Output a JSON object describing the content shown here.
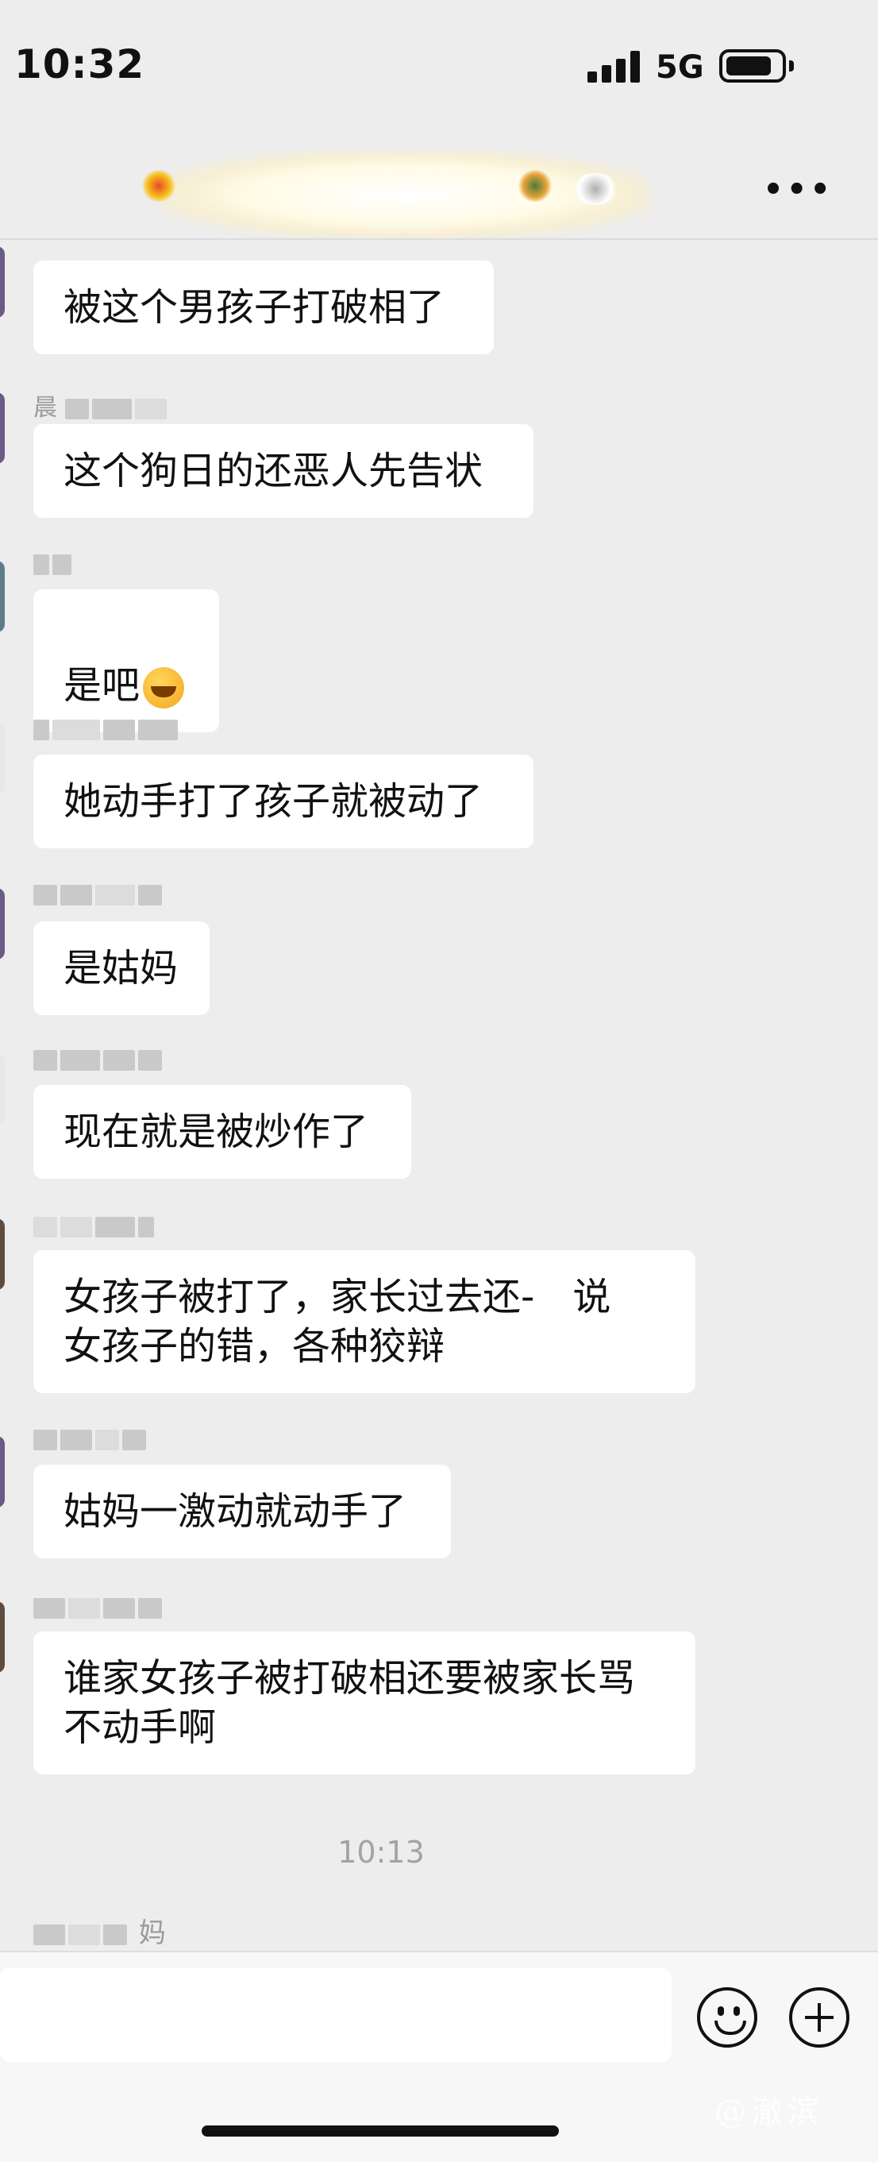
{
  "status_bar": {
    "time": "10:32",
    "network": "5G"
  },
  "messages": [
    {
      "text": "被这个男孩子打破相了"
    },
    {
      "name": "晨",
      "text": "这个狗日的还恶人先告状"
    },
    {
      "text": "是吧",
      "emoji": "crying-laughing-emoji"
    },
    {
      "text": "她动手打了孩子就被动了"
    },
    {
      "text": "是姑妈"
    },
    {
      "text": "现在就是被炒作了"
    },
    {
      "text": "女孩子被打了，家长过去还-　说\n女孩子的错，各种狡辩"
    },
    {
      "text": "姑妈一激动就动手了"
    },
    {
      "text": "谁家女孩子被打破相还要被家长骂\n不动手啊"
    }
  ],
  "timestamp": "10:13",
  "last_sender_partial": "妈",
  "watermark": "@澈滨",
  "colors": {
    "background": "#ededed",
    "bubble": "#ffffff",
    "timestamp": "#a3a3a3"
  }
}
